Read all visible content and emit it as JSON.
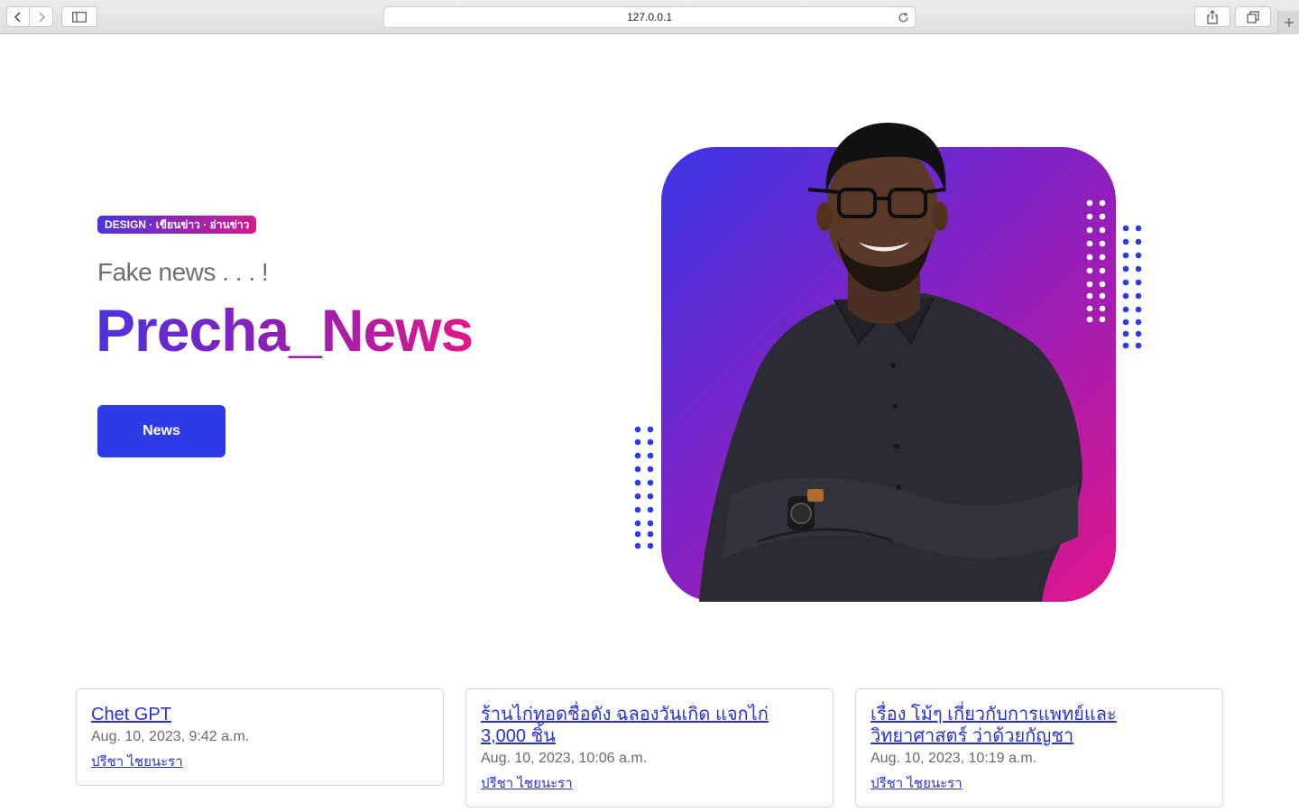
{
  "browser": {
    "url": "127.0.0.1"
  },
  "hero": {
    "badge": "DESIGN · เขียนข่าว · อ่านข่าว",
    "subtitle": "Fake news . . . !",
    "title": "Precha_News",
    "button_label": "News",
    "colors": {
      "primary": "#2e3ae6",
      "gradient_start": "#4a33df",
      "gradient_end": "#e0178a",
      "dots": "#2e3ae6"
    }
  },
  "news_cards": [
    {
      "title": "Chet GPT",
      "date": "Aug. 10, 2023, 9:42 a.m.",
      "author": "ปรีชา ไชยนะรา"
    },
    {
      "title": "ร้านไก่ทอดชื่อดัง ฉลองวันเกิด แจกไก่ 3,000 ชิ้น",
      "date": "Aug. 10, 2023, 10:06 a.m.",
      "author": "ปรีชา ไชยนะรา"
    },
    {
      "title": "เรื่อง โม้ๆ เกี่ยวกับการแพทย์และวิทยาศาสตร์ ว่าด้วยกัญชา",
      "date": "Aug. 10, 2023, 10:19 a.m.",
      "author": "ปรีชา ไชยนะรา"
    }
  ]
}
